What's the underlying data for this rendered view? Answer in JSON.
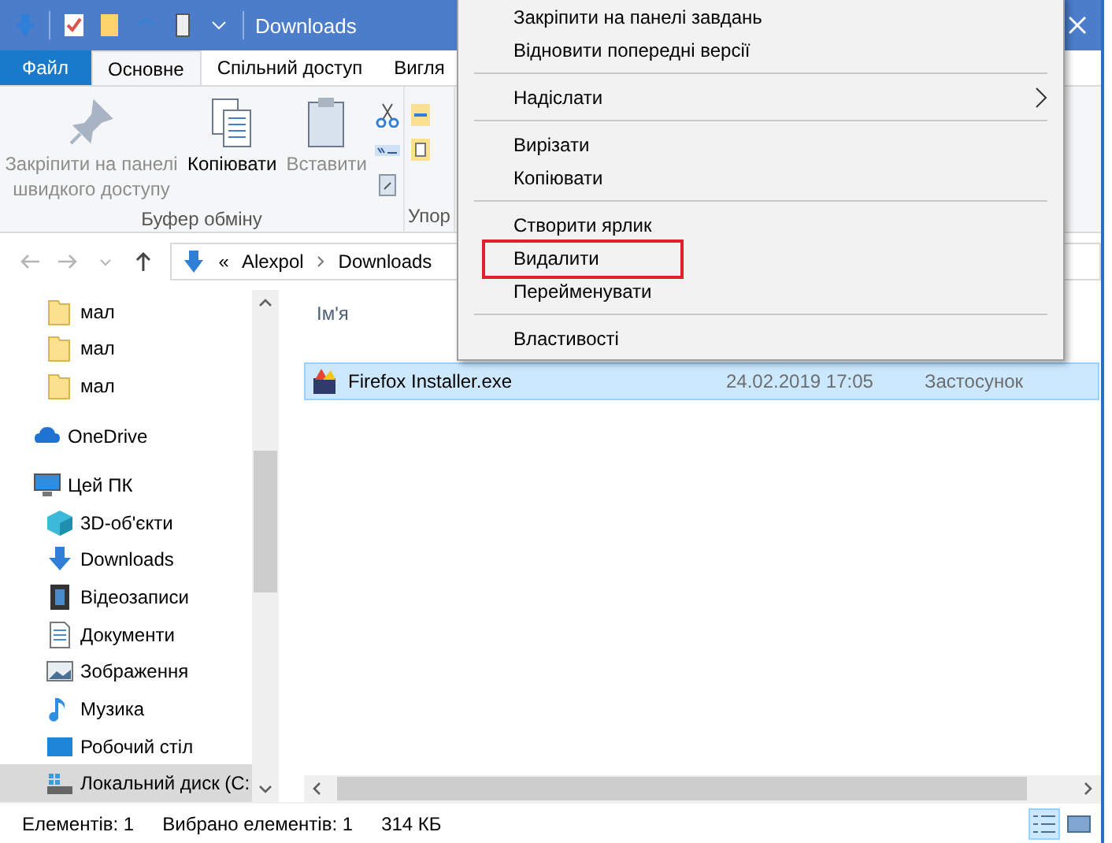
{
  "window": {
    "title": "Downloads"
  },
  "ribbon_tabs": [
    {
      "label": "Файл",
      "kind": "file",
      "selected": false
    },
    {
      "label": "Основне",
      "kind": "tab",
      "selected": true
    },
    {
      "label": "Спільний доступ",
      "kind": "tab",
      "selected": false
    },
    {
      "label": "Вигля",
      "kind": "tab",
      "selected": false
    }
  ],
  "ribbon": {
    "groups": [
      {
        "label": "Буфер обміну",
        "buttons": [
          {
            "label": "Закріпити на панелі швидкого доступу",
            "kind": "pin",
            "disabled": true
          },
          {
            "label": "Копіювати",
            "kind": "copy",
            "disabled": false
          },
          {
            "label": "Вставити",
            "kind": "paste",
            "disabled": true
          }
        ]
      },
      {
        "label": "Упор"
      }
    ]
  },
  "address": {
    "overflow": "«",
    "path": [
      "Alexpol",
      "Downloads"
    ]
  },
  "nav_pane": {
    "quick_access_items": [
      {
        "label": "мал",
        "selected": false
      },
      {
        "label": "мал",
        "selected": false
      },
      {
        "label": "мал",
        "selected": false
      }
    ],
    "items": [
      {
        "label": "OneDrive",
        "kind": "cloud",
        "selected": false
      },
      {
        "label": "Цей ПК",
        "kind": "pc",
        "selected": false,
        "children": [
          {
            "label": "3D-об'єкти",
            "kind": "cube",
            "selected": false
          },
          {
            "label": "Downloads",
            "kind": "download",
            "selected": false
          },
          {
            "label": "Відеозаписи",
            "kind": "video",
            "selected": false
          },
          {
            "label": "Документи",
            "kind": "document",
            "selected": false
          },
          {
            "label": "Зображення",
            "kind": "image",
            "selected": false
          },
          {
            "label": "Музика",
            "kind": "music",
            "selected": false
          },
          {
            "label": "Робочий стіл",
            "kind": "desktop",
            "selected": false
          },
          {
            "label": "Локальний диск (C:",
            "kind": "drive",
            "selected": true
          }
        ]
      }
    ]
  },
  "file_list": {
    "columns": [
      "Ім'я"
    ],
    "rows": [
      {
        "name": "Firefox Installer.exe",
        "date": "24.02.2019 17:05",
        "type": "Застосунок",
        "selected": true
      }
    ]
  },
  "context_menu": {
    "items": [
      {
        "kind": "item",
        "label": "Закріпити на панелі завдань",
        "submenu": false,
        "outlined": false
      },
      {
        "kind": "item",
        "label": "Відновити попередні версії",
        "submenu": false,
        "outlined": false
      },
      {
        "kind": "separator"
      },
      {
        "kind": "item",
        "label": "Надіслати",
        "submenu": true,
        "outlined": false
      },
      {
        "kind": "separator"
      },
      {
        "kind": "item",
        "label": "Вирізати",
        "submenu": false,
        "outlined": false
      },
      {
        "kind": "item",
        "label": "Копіювати",
        "submenu": false,
        "outlined": false
      },
      {
        "kind": "separator"
      },
      {
        "kind": "item",
        "label": "Створити ярлик",
        "submenu": false,
        "outlined": false
      },
      {
        "kind": "item",
        "label": "Видалити",
        "submenu": false,
        "outlined": true
      },
      {
        "kind": "item",
        "label": "Перейменувати",
        "submenu": false,
        "outlined": false
      },
      {
        "kind": "separator"
      },
      {
        "kind": "item",
        "label": "Властивості",
        "submenu": false,
        "outlined": false
      }
    ]
  },
  "status_bar": {
    "items": [
      "Елементів: 1",
      "Вибрано елементів: 1",
      "314 КБ"
    ],
    "views": [
      {
        "kind": "details",
        "selected": true
      },
      {
        "kind": "large-icons",
        "selected": false
      }
    ]
  }
}
